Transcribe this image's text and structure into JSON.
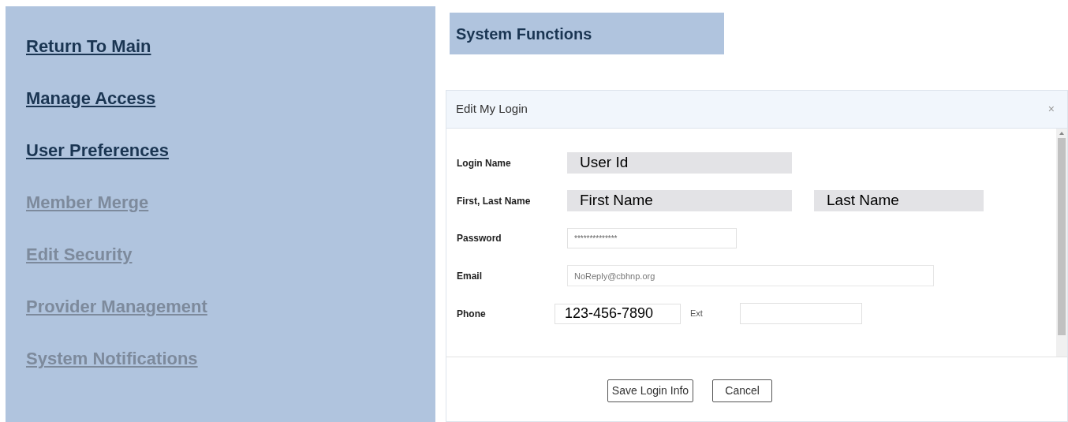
{
  "sidebar": {
    "items": [
      {
        "label": "Return To Main",
        "disabled": false
      },
      {
        "label": "Manage Access",
        "disabled": false
      },
      {
        "label": "User Preferences",
        "disabled": false
      },
      {
        "label": "Member Merge",
        "disabled": true
      },
      {
        "label": "Edit Security",
        "disabled": true
      },
      {
        "label": "Provider Management",
        "disabled": true
      },
      {
        "label": "System Notifications",
        "disabled": true
      }
    ]
  },
  "heading": "System Functions",
  "dialog": {
    "title": "Edit My Login",
    "close": "×",
    "rows": [
      {
        "label": "Login Name",
        "fields": [
          {
            "kind": "shaded",
            "value": "User Id"
          }
        ]
      },
      {
        "label": "First, Last Name",
        "fields": [
          {
            "kind": "shaded",
            "value": "First Name"
          },
          {
            "kind": "shaded",
            "value": "Last Name"
          }
        ]
      },
      {
        "label": "Password",
        "fields": [
          {
            "kind": "password",
            "value": "**************"
          }
        ]
      },
      {
        "label": "Email",
        "fields": [
          {
            "kind": "wide",
            "placeholder": "NoReply@cbhnp.org"
          }
        ]
      },
      {
        "label": "Phone",
        "fields": [
          {
            "kind": "phone",
            "value": "123-456-7890"
          },
          {
            "kind": "ext",
            "label": "Ext"
          }
        ]
      }
    ],
    "buttons": [
      "Save Login Info",
      "Cancel"
    ]
  }
}
